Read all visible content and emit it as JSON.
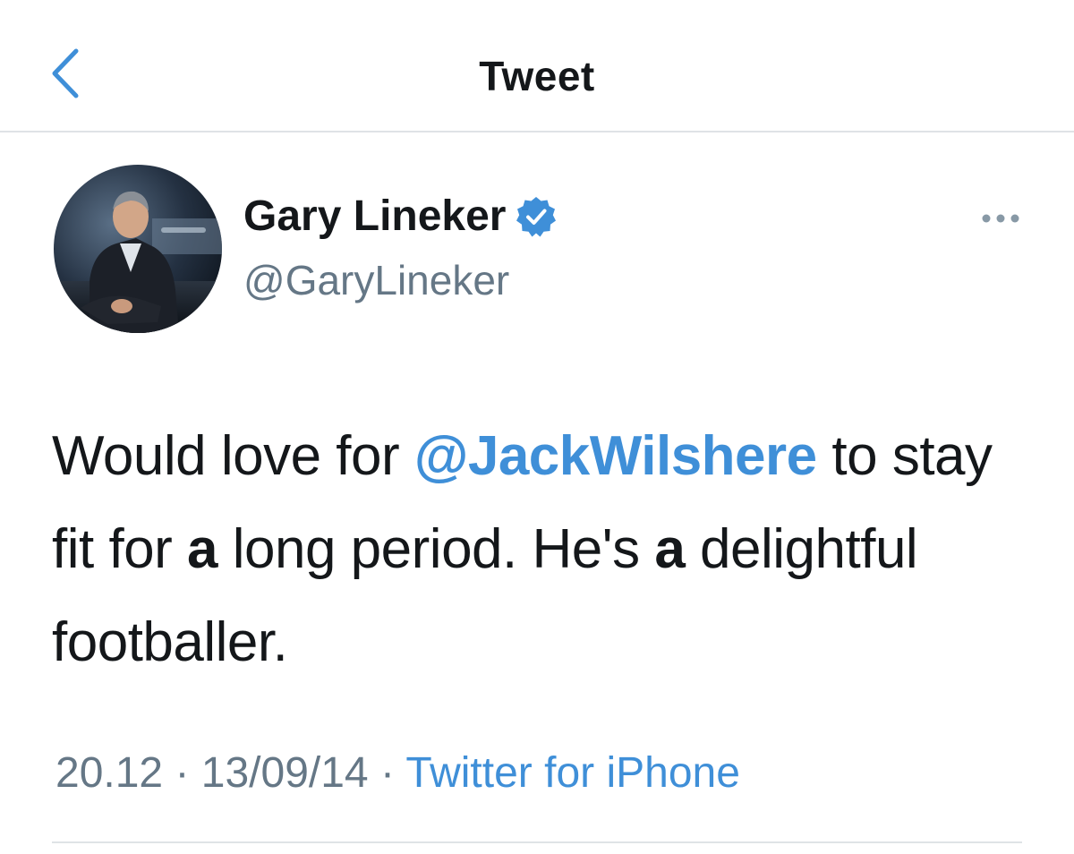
{
  "nav": {
    "title": "Tweet",
    "back_icon": "chevron-left-icon"
  },
  "colors": {
    "accent": "#3f8fd8",
    "text": "#14171a",
    "secondary": "#657786",
    "divider": "#dfe3e6"
  },
  "tweet": {
    "author": {
      "display_name": "Gary Lineker",
      "handle": "@GaryLineker",
      "verified_icon": "verified-badge-icon"
    },
    "more_icon": "more-horizontal-icon",
    "text": {
      "part1": "Would love for ",
      "mention": "@JackWilshere",
      "part2": " to stay fit for ",
      "bold1": "a",
      "part3": " long period. He's ",
      "bold2": "a",
      "part4": " delightful footballer."
    },
    "meta": {
      "time": "20.12",
      "separator1": " · ",
      "date": "13/09/14",
      "separator2": " · ",
      "source": "Twitter for iPhone"
    }
  }
}
